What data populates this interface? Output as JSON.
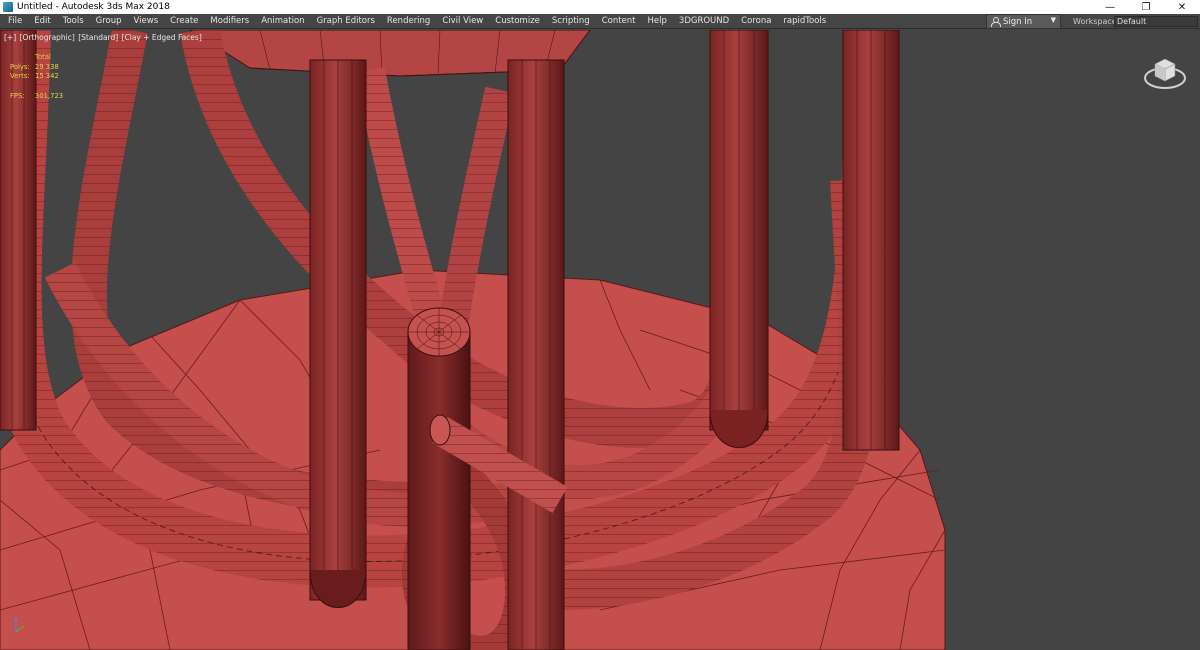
{
  "window": {
    "title": "Untitled - Autodesk 3ds Max 2018",
    "minimize": "—",
    "restore": "❐",
    "close": "✕"
  },
  "menu": {
    "items": [
      "File",
      "Edit",
      "Tools",
      "Group",
      "Views",
      "Create",
      "Modifiers",
      "Animation",
      "Graph Editors",
      "Rendering",
      "Civil View",
      "Customize",
      "Scripting",
      "Content",
      "Help",
      "3DGROUND",
      "Corona",
      "rapidTools"
    ],
    "sign_in": "Sign In",
    "workspaces_label": "Workspaces:",
    "workspaces_value": "Default"
  },
  "viewport": {
    "label_plus": "[+]",
    "label_view": "[Orthographic]",
    "label_shading": "[Standard]",
    "label_style": "[Clay + Edged Faces]",
    "stats": {
      "header": "Total",
      "polys_label": "Polys:",
      "polys_value": "29 338",
      "verts_label": "Verts:",
      "verts_value": "15 342",
      "fps_label": "FPS:",
      "fps_value": "301,723"
    },
    "colors": {
      "background": "#444444",
      "clay": "#c04a48",
      "edges": "#3a0d0d",
      "stats_text": "#e6d34a"
    }
  }
}
